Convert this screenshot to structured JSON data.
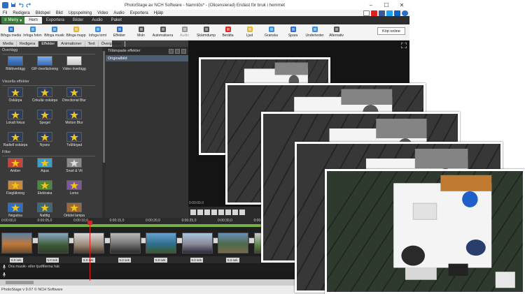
{
  "window": {
    "title": "PhotoStage av NCH Software - Namnlös* - (Olicensierad) Endast för bruk i hemmet",
    "controls": [
      "–",
      "☐",
      "✕"
    ]
  },
  "menubar": {
    "items": [
      "Fil",
      "Redigera",
      "Bildspel",
      "Bild",
      "Uppspelning",
      "Video",
      "Audio",
      "Exportera",
      "Hjälp"
    ]
  },
  "tabs": {
    "meny_label": "Meny",
    "items": [
      "Hem",
      "Exportera",
      "Bilder",
      "Audio",
      "Paket"
    ],
    "active": "Hem"
  },
  "toolbar": {
    "items": [
      {
        "label": "Bifoga media",
        "icon": "add-media-icon",
        "color": "#2b6fc6"
      },
      {
        "label": "Infoga foton",
        "icon": "add-photos-icon",
        "color": "#3a8fd8"
      },
      {
        "label": "Bifoga musik",
        "icon": "add-music-icon",
        "color": "#3a8fd8"
      },
      {
        "label": "Bifoga mapp",
        "icon": "add-folder-icon",
        "color": "#e5b83a"
      },
      {
        "label": "Infoga tomt",
        "icon": "add-blank-icon",
        "color": "#3a8fd8"
      },
      {
        "label": "Effekter",
        "icon": "effects-icon",
        "color": "#2b6fc6"
      },
      {
        "label": "Moln",
        "icon": "cloud-icon",
        "color": "#555555"
      },
      {
        "label": "Automatisera",
        "icon": "automate-icon",
        "color": "#555555"
      },
      {
        "label": "Audio",
        "icon": "audio-icon",
        "color": "#999999"
      },
      {
        "label": "Skärmdump",
        "icon": "screenshot-icon",
        "color": "#555555"
      },
      {
        "label": "Berätta",
        "icon": "narrate-icon",
        "color": "#d62b2b"
      },
      {
        "label": "Ljud",
        "icon": "sound-icon",
        "color": "#e5b83a"
      },
      {
        "label": "Granska",
        "icon": "review-icon",
        "color": "#3a8fd8"
      },
      {
        "label": "Spara",
        "icon": "save-icon",
        "color": "#2b6fc6"
      },
      {
        "label": "Undertexter",
        "icon": "subtitles-icon",
        "color": "#3a8fd8"
      },
      {
        "label": "Alternativ",
        "icon": "options-icon",
        "color": "#555555"
      }
    ],
    "buy_label": "Köp online"
  },
  "left_tabs": {
    "items": [
      "Media",
      "Redigera",
      "Effekter",
      "Animationer",
      "Text",
      "Övergångar"
    ],
    "active": "Effekter"
  },
  "effects": {
    "sections": [
      {
        "title": "Överlägg",
        "items": [
          "Bildöverlägg",
          "GIF-överläckning",
          "Video överlägg"
        ]
      },
      {
        "title": "Visuella effekter",
        "items": [
          "Oskärpa",
          "Cirkulär oskärpa",
          "Directional Blur",
          "Lokalt fokus",
          "Spegel",
          "Motion Blur",
          "Radiell oskärpa",
          "Nyans",
          "Tvåfärgad"
        ]
      },
      {
        "title": "Filter",
        "items": [
          "Amber",
          "Aqua",
          "Svart & Vit",
          "Färgläkning",
          "Elektraka",
          "Lomo",
          "Negativa",
          "Natttig",
          "Orkdel lampa"
        ]
      }
    ]
  },
  "applied_effects": {
    "title": "Tillämpade effekter",
    "items": [
      "Originalbild"
    ]
  },
  "preview": {
    "timecode": "0:00:00.0"
  },
  "timeline": {
    "ruler": [
      "0:00:00,0",
      "0:00:05,0",
      "0:00:10,0",
      "0:00:15,0",
      "0:00:20,0",
      "0:00:25,0",
      "0:00:30,0",
      "0:00:35,0"
    ],
    "durations": [
      "5.0 sek",
      "5.0 sek",
      "5.0 sek",
      "5.0 sek",
      "5.0 sek",
      "5.0 sek",
      "5.0 sek"
    ],
    "transition_label": "1.0",
    "audio_placeholder": "Dra musik- eller ljudfilerna här."
  },
  "status": {
    "text": "PhotoStage v 9.07 © NCH Software"
  }
}
